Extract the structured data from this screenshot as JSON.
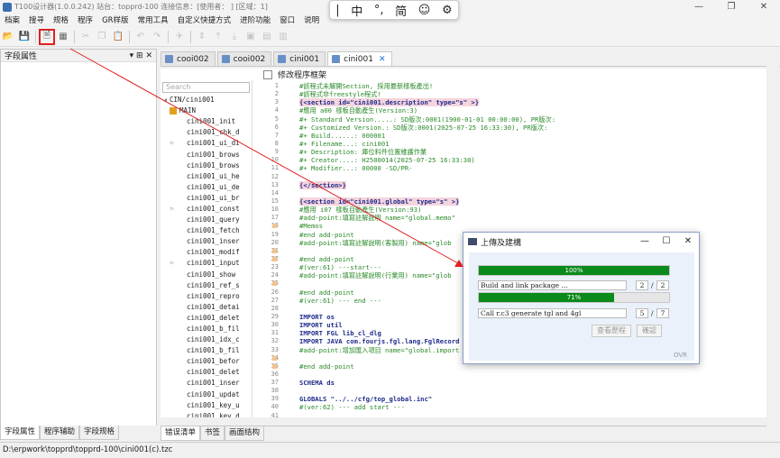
{
  "window": {
    "title": "T100设计器(1.0.0.242) 站台：topprd-100 连接信息：[使用者：          ] [区域：1]",
    "controls": [
      "—",
      "❐",
      "✕"
    ]
  },
  "ime": {
    "items": [
      "|",
      "中",
      "°,",
      "简",
      "☺",
      "⚙"
    ]
  },
  "menu": [
    "档案",
    "搜寻",
    "规格",
    "程序",
    "GR样版",
    "常用工具",
    "自定义快捷方式",
    "进阶功能",
    "窗口",
    "说明"
  ],
  "toolbar": {
    "icons": [
      "folder-open-icon",
      "save-icon",
      "new-file-icon",
      "form-design-icon",
      "cut-icon",
      "copy-icon",
      "paste-icon",
      "undo-icon",
      "redo-icon",
      "build-icon",
      "move-up-icon",
      "move-top-icon",
      "move-bottom-icon",
      "copy-block-icon",
      "paste-block-icon",
      "save-all-icon"
    ]
  },
  "left_panel": {
    "title": "字段属性",
    "controls": "▾ ⊞ ✕",
    "tabs": [
      "字段属性",
      "程序辅助",
      "字段规格"
    ]
  },
  "editor_tabs": [
    {
      "label": "cooi002",
      "active": false
    },
    {
      "label": "cooi002",
      "active": false
    },
    {
      "label": "cini001",
      "active": false
    },
    {
      "label": "cini001",
      "active": true,
      "close": "✕"
    }
  ],
  "form_bar": {
    "label": "修改程序框架"
  },
  "outline": {
    "search_placeholder": "Search",
    "root": "CIN/cini001",
    "items": [
      {
        "label": "MAIN",
        "arrow": ""
      },
      {
        "label": "cini001_init",
        "arrow": ""
      },
      {
        "label": "cini001_chk_d",
        "arrow": ""
      },
      {
        "label": "cini001_ui_di",
        "arrow": "▷"
      },
      {
        "label": "cini001_brows",
        "arrow": ""
      },
      {
        "label": "cini001_brows",
        "arrow": ""
      },
      {
        "label": "cini001_ui_he",
        "arrow": ""
      },
      {
        "label": "cini001_ui_de",
        "arrow": ""
      },
      {
        "label": "cini001_ui_br",
        "arrow": ""
      },
      {
        "label": "cini001_const",
        "arrow": "▷"
      },
      {
        "label": "cini001_query",
        "arrow": ""
      },
      {
        "label": "cini001_fetch",
        "arrow": ""
      },
      {
        "label": "cini001_inser",
        "arrow": ""
      },
      {
        "label": "cini001_modif",
        "arrow": ""
      },
      {
        "label": "cini001_input",
        "arrow": "▷"
      },
      {
        "label": "cini001_show",
        "arrow": ""
      },
      {
        "label": "cini001_ref_s",
        "arrow": ""
      },
      {
        "label": "cini001_repro",
        "arrow": ""
      },
      {
        "label": "cini001_detai",
        "arrow": ""
      },
      {
        "label": "cini001_delet",
        "arrow": ""
      },
      {
        "label": "cini001_b_fil",
        "arrow": ""
      },
      {
        "label": "cini001_idx_c",
        "arrow": ""
      },
      {
        "label": "cini001_b_fil",
        "arrow": ""
      },
      {
        "label": "cini001_befor",
        "arrow": ""
      },
      {
        "label": "cini001_delet",
        "arrow": ""
      },
      {
        "label": "cini001_inser",
        "arrow": ""
      },
      {
        "label": "cini001_updat",
        "arrow": ""
      },
      {
        "label": "cini001_key_u",
        "arrow": ""
      },
      {
        "label": "cini001_key_d",
        "arrow": ""
      }
    ]
  },
  "code": {
    "line_numbers": [
      "1",
      "2",
      "3",
      "4",
      "5",
      "6",
      "7",
      "8",
      "9",
      "10",
      "11",
      "12",
      "13",
      "14",
      "15",
      "16",
      "17",
      "18",
      "19",
      "20",
      "21",
      "22",
      "23",
      "24",
      "25",
      "26",
      "27",
      "28",
      "29",
      "30",
      "31",
      "32",
      "33",
      "34",
      "35",
      "36",
      "37",
      "38",
      "39",
      "40",
      "41"
    ],
    "breakpoint_lines": [
      "18",
      "21",
      "22",
      "25",
      "34",
      "35"
    ],
    "lines": [
      {
        "t": "#該程式未解開Section, 採用最新樣板產出!",
        "c": "c-green"
      },
      {
        "t": "#該程式非freestyle程式!",
        "c": "c-green"
      },
      {
        "t": "{<section id=\"cini001.description\" type=\"s\" >}",
        "c": "c-sect"
      },
      {
        "t": "#應用 a00 樣板自動產生(Version:3)",
        "c": "c-green"
      },
      {
        "t": "#+ Standard Version.....: SD版次:0001(1900-01-01 00:00:00), PR版次:",
        "c": "c-green"
      },
      {
        "t": "#+ Customized Version.: SD版次:0001(2025-07-25 16:33:30), PR版次:",
        "c": "c-green"
      },
      {
        "t": "#+ Build......: 000001",
        "c": "c-green"
      },
      {
        "t": "#+ Filename...: cini001",
        "c": "c-green"
      },
      {
        "t": "#+ Description: 庫位料件位置維護作業",
        "c": "c-green"
      },
      {
        "t": "#+ Creator....: H2500014(2025-07-25 16:33:30)",
        "c": "c-green"
      },
      {
        "t": "#+ Modifier...: 00000 -SD/PR-",
        "c": "c-green"
      },
      {
        "t": "",
        "c": "c-blk"
      },
      {
        "t": "{</section>}",
        "c": "c-sect"
      },
      {
        "t": "",
        "c": "c-blk"
      },
      {
        "t": "{<section id=\"cini001.global\" type=\"s\" >}",
        "c": "c-sect"
      },
      {
        "t": "#應用 i07 樣板自動產生(Version:93)",
        "c": "c-green"
      },
      {
        "t": "#add-point:填寫註解說明 name=\"global.memo\"",
        "c": "c-green"
      },
      {
        "t": "#Memos",
        "c": "c-green"
      },
      {
        "t": "#end add-point",
        "c": "c-green"
      },
      {
        "t": "#add-point:填寫註解說明(客製用) name=\"glob",
        "c": "c-green"
      },
      {
        "t": "",
        "c": "c-blk"
      },
      {
        "t": "#end add-point",
        "c": "c-green"
      },
      {
        "t": "#(ver:61) ---start---",
        "c": "c-green"
      },
      {
        "t": "#add-point:填寫註解說明(行業用) name=\"glob",
        "c": "c-green"
      },
      {
        "t": "",
        "c": "c-blk"
      },
      {
        "t": "#end add-point",
        "c": "c-green"
      },
      {
        "t": "#(ver:61) --- end ---",
        "c": "c-green"
      },
      {
        "t": "",
        "c": "c-blk"
      },
      {
        "t": "IMPORT os",
        "c": "c-kw"
      },
      {
        "t": "IMPORT util",
        "c": "c-kw"
      },
      {
        "t": "IMPORT FGL lib_cl_dlg",
        "c": "c-kw"
      },
      {
        "t": "IMPORT JAVA com.fourjs.fgl.lang.FglRecord",
        "c": "c-kw"
      },
      {
        "t": "#add-point:增加匯入項目 name=\"global.import",
        "c": "c-green"
      },
      {
        "t": "",
        "c": "c-blk"
      },
      {
        "t": "#end add-point",
        "c": "c-green"
      },
      {
        "t": "",
        "c": "c-blk"
      },
      {
        "t": "SCHEMA ds",
        "c": "c-kw"
      },
      {
        "t": "",
        "c": "c-blk"
      },
      {
        "t": "GLOBALS \"../../cfg/top_global.inc\"",
        "c": "c-kw"
      },
      {
        "t": "#(ver:62) --- add start ---",
        "c": "c-green"
      },
      {
        "t": "",
        "c": "c-blk"
      }
    ]
  },
  "bottom_tabs": [
    "错误清单",
    "书签",
    "画面结构"
  ],
  "status": {
    "path": "D:\\erpwork\\topprd\\topprd-100\\cini001(c).tzc"
  },
  "dialog": {
    "title": "上傳及建構",
    "controls": [
      "—",
      "☐",
      "✕"
    ],
    "progress1": {
      "percent_label": "100%",
      "fraction": 1.0,
      "task": "Build and link package ...",
      "current": "2",
      "total": "2",
      "sep": "/"
    },
    "progress2": {
      "percent_label": "71%",
      "fraction": 0.71,
      "task": "Call r.c3 generate tgl and 4gl",
      "current": "5",
      "total": "7",
      "sep": "/"
    },
    "buttons": [
      "查看歷程",
      "確認"
    ],
    "mode": "OVR",
    "accent": "#0a8a1a"
  },
  "annotation": {
    "color": "#e02020"
  }
}
